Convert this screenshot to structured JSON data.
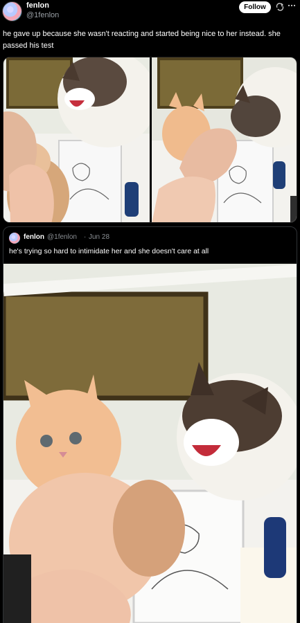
{
  "post": {
    "author": {
      "display_name": "fenlon",
      "handle": "@1fenlon"
    },
    "follow_label": "Follow",
    "text": "he gave up because she wasn't reacting and started being nice to her instead. she passed his test"
  },
  "quote": {
    "author": {
      "display_name": "fenlon",
      "handle": "@1fenlon"
    },
    "separator": "·",
    "date": "Jun 28",
    "text": "he's trying so hard to intimidate her and she doesn't care at all"
  },
  "icons": {
    "avatar": "avatar-icon",
    "retweet": "retweet-icon",
    "more": "more-icon"
  },
  "colors": {
    "background": "#000000",
    "text": "#ffffff",
    "muted": "#9aa0a6",
    "follow_bg": "#ffffff"
  }
}
